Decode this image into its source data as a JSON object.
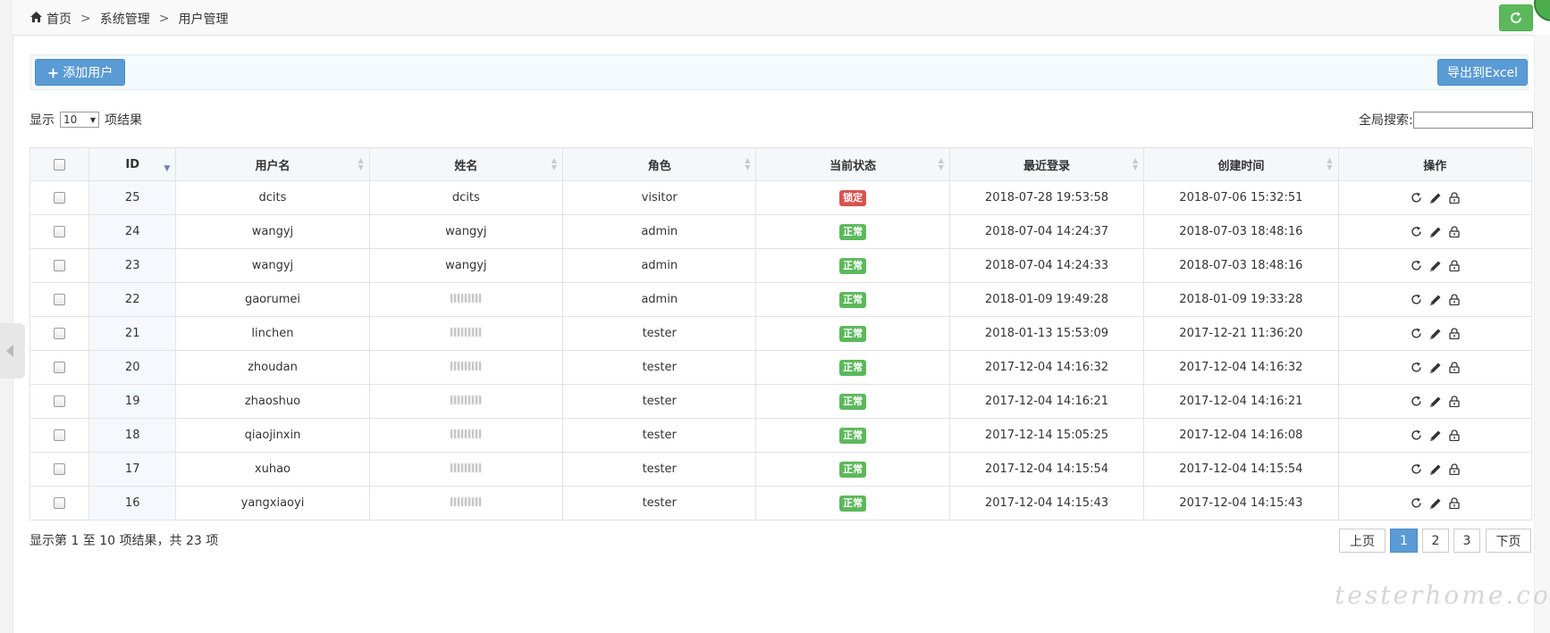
{
  "breadcrumb": {
    "home": "首页",
    "sep": ">",
    "section": "系统管理",
    "page": "用户管理"
  },
  "toolbar": {
    "add_label": "添加用户",
    "export_label": "导出到Excel"
  },
  "length": {
    "prefix": "显示",
    "value": "10",
    "suffix": "项结果"
  },
  "search": {
    "label": "全局搜索:",
    "value": ""
  },
  "table": {
    "headers": [
      "ID",
      "用户名",
      "姓名",
      "角色",
      "当前状态",
      "最近登录",
      "创建时间",
      "操作"
    ],
    "rows": [
      {
        "id": "25",
        "username": "dcits",
        "name": "dcits",
        "role": "visitor",
        "status": "锁定",
        "status_type": "lock",
        "last_login": "2018-07-28 19:53:58",
        "created": "2018-07-06 15:32:51"
      },
      {
        "id": "24",
        "username": "wangyj",
        "name": "wangyj",
        "role": "admin",
        "status": "正常",
        "status_type": "ok",
        "last_login": "2018-07-04 14:24:37",
        "created": "2018-07-03 18:48:16"
      },
      {
        "id": "23",
        "username": "wangyj",
        "name": "wangyj",
        "role": "admin",
        "status": "正常",
        "status_type": "ok",
        "last_login": "2018-07-04 14:24:33",
        "created": "2018-07-03 18:48:16"
      },
      {
        "id": "22",
        "username": "gaorumei",
        "name": "",
        "role": "admin",
        "status": "正常",
        "status_type": "ok",
        "last_login": "2018-01-09 19:49:28",
        "created": "2018-01-09 19:33:28"
      },
      {
        "id": "21",
        "username": "linchen",
        "name": "",
        "role": "tester",
        "status": "正常",
        "status_type": "ok",
        "last_login": "2018-01-13 15:53:09",
        "created": "2017-12-21 11:36:20"
      },
      {
        "id": "20",
        "username": "zhoudan",
        "name": "",
        "role": "tester",
        "status": "正常",
        "status_type": "ok",
        "last_login": "2017-12-04 14:16:32",
        "created": "2017-12-04 14:16:32"
      },
      {
        "id": "19",
        "username": "zhaoshuo",
        "name": "",
        "role": "tester",
        "status": "正常",
        "status_type": "ok",
        "last_login": "2017-12-04 14:16:21",
        "created": "2017-12-04 14:16:21"
      },
      {
        "id": "18",
        "username": "qiaojinxin",
        "name": "",
        "role": "tester",
        "status": "正常",
        "status_type": "ok",
        "last_login": "2017-12-14 15:05:25",
        "created": "2017-12-04 14:16:08"
      },
      {
        "id": "17",
        "username": "xuhao",
        "name": "",
        "role": "tester",
        "status": "正常",
        "status_type": "ok",
        "last_login": "2017-12-04 14:15:54",
        "created": "2017-12-04 14:15:54"
      },
      {
        "id": "16",
        "username": "yangxiaoyi",
        "name": "",
        "role": "tester",
        "status": "正常",
        "status_type": "ok",
        "last_login": "2017-12-04 14:15:43",
        "created": "2017-12-04 14:15:43"
      }
    ]
  },
  "footer": {
    "info": "显示第 1 至 10 项结果，共 23 项"
  },
  "pagination": {
    "prev": "上页",
    "pages": [
      "1",
      "2",
      "3"
    ],
    "active": "1",
    "next": "下页"
  },
  "watermark": "testerhome.com",
  "icons": {
    "home": "home-icon",
    "refresh": "refresh-icon",
    "row_reset": "reset-password-icon",
    "row_edit": "pencil-icon",
    "row_lock": "lock-icon"
  },
  "colors": {
    "primary": "#5b9bd5",
    "success": "#5cb85c",
    "danger": "#d9534f"
  }
}
